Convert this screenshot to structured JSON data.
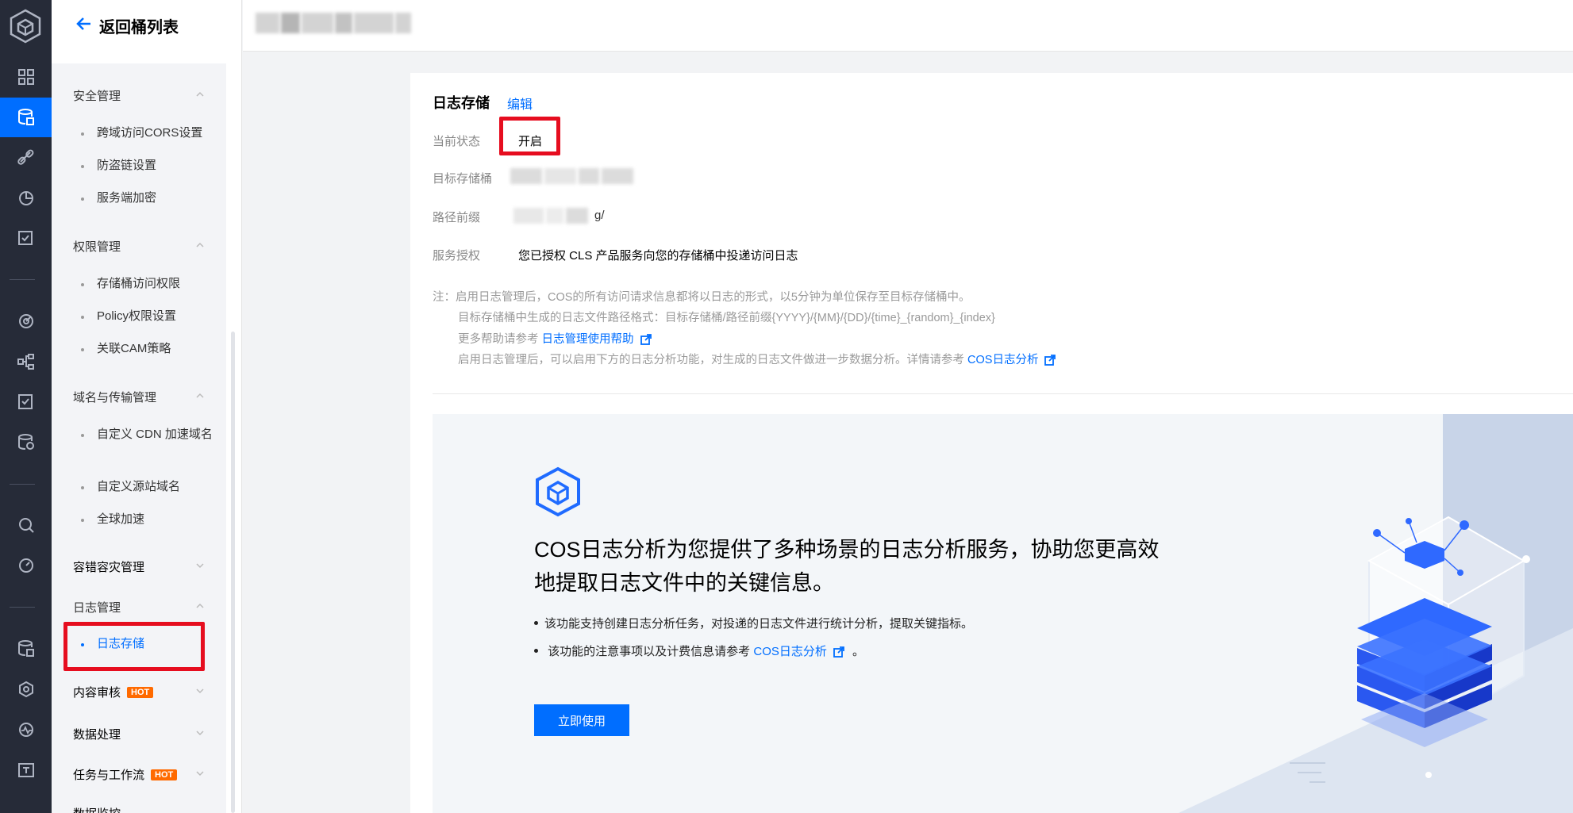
{
  "nav": {
    "back_label": "返回桶列表",
    "groups": [
      {
        "label": "安全管理",
        "items": [
          "跨域访问CORS设置",
          "防盗链设置",
          "服务端加密"
        ]
      },
      {
        "label": "权限管理",
        "items": [
          "存储桶访问权限",
          "Policy权限设置",
          "关联CAM策略"
        ]
      },
      {
        "label": "域名与传输管理",
        "items": [
          "自定义 CDN 加速域名",
          "自定义源站域名",
          "全球加速"
        ]
      },
      {
        "label": "容错容灾管理"
      },
      {
        "label": "日志管理",
        "items": [
          "日志存储"
        ]
      },
      {
        "label": "内容审核",
        "badge": "HOT"
      },
      {
        "label": "数据处理"
      },
      {
        "label": "任务与工作流",
        "badge": "HOT"
      },
      {
        "label": "数据监控"
      }
    ]
  },
  "log_storage": {
    "title": "日志存储",
    "edit_label": "编辑",
    "status_label": "当前状态",
    "status_value": "开启",
    "target_bucket_label": "目标存储桶",
    "path_prefix_label": "路径前缀",
    "path_prefix_visible_suffix": "g/",
    "auth_label": "服务授权",
    "auth_value": "您已授权 CLS 产品服务向您的存储桶中投递访问日志",
    "note_1": "注：启用日志管理后，COS的所有访问请求信息都将以日志的形式，以5分钟为单位保存至目标存储桶中。",
    "note_2": "目标存储桶中生成的日志文件路径格式：目标存储桶/路径前缀{YYYY}/{MM}/{DD}/{time}_{random}_{index}",
    "note_3_prefix": "更多帮助请参考",
    "note_3_link": "日志管理使用帮助",
    "note_4_prefix": "启用日志管理后，可以启用下方的日志分析功能，对生成的日志文件做进一步数据分析。详情请参考",
    "note_4_link": "COS日志分析"
  },
  "promo": {
    "heading_line1": "COS日志分析为您提供了多种场景的日志分析服务，协助您更高效",
    "heading_line2": "地提取日志文件中的关键信息。",
    "bullet_1": "该功能支持创建日志分析任务，对投递的日志文件进行统计分析，提取关键指标。",
    "bullet_2_prefix": "该功能的注意事项以及计费信息请参考",
    "bullet_2_link": "COS日志分析",
    "bullet_2_suffix": "。",
    "button_label": "立即使用"
  },
  "colors": {
    "accent": "#006eff",
    "highlight": "#e60d1f",
    "hot": "#ff6a00",
    "rail": "#262b38"
  }
}
